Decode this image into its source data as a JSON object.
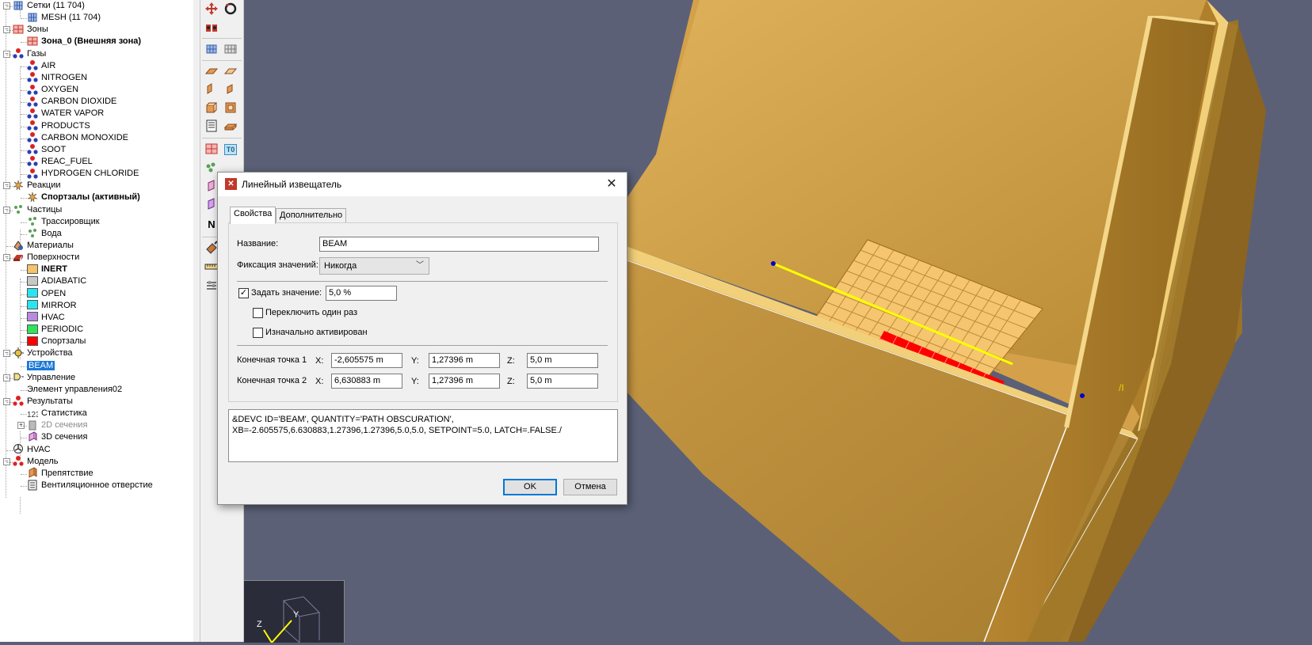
{
  "tree": {
    "items": [
      {
        "label": "Сетки (11 704)",
        "icon": "mesh-icon"
      },
      {
        "label": "MESH (11 704)",
        "icon": "mesh-icon"
      },
      {
        "label": "Зоны",
        "icon": "zone-icon"
      },
      {
        "label": "Зона_0 (Внешняя зона)",
        "icon": "zone-icon"
      },
      {
        "label": "Газы",
        "icon": "molecule-icon"
      },
      {
        "label": "AIR",
        "icon": "molecule-icon"
      },
      {
        "label": "NITROGEN",
        "icon": "molecule-icon"
      },
      {
        "label": "OXYGEN",
        "icon": "molecule-icon"
      },
      {
        "label": "CARBON DIOXIDE",
        "icon": "molecule-icon"
      },
      {
        "label": "WATER VAPOR",
        "icon": "molecule-icon"
      },
      {
        "label": "PRODUCTS",
        "icon": "molecule-icon"
      },
      {
        "label": "CARBON MONOXIDE",
        "icon": "molecule-icon"
      },
      {
        "label": "SOOT",
        "icon": "molecule-icon"
      },
      {
        "label": "REAC_FUEL",
        "icon": "molecule-icon"
      },
      {
        "label": "HYDROGEN CHLORIDE",
        "icon": "molecule-icon"
      },
      {
        "label": "Реакции",
        "icon": "reaction-icon"
      },
      {
        "label": "Спортзалы (активный)",
        "icon": "reaction-icon"
      },
      {
        "label": "Частицы",
        "icon": "particles-icon"
      },
      {
        "label": "Трассировщик",
        "icon": "particles-icon"
      },
      {
        "label": "Вода",
        "icon": "particles-icon"
      },
      {
        "label": "Материалы",
        "icon": "materials-icon"
      },
      {
        "label": "Поверхности",
        "icon": "surface-icon"
      },
      {
        "label": "INERT",
        "color": "#f5c36a"
      },
      {
        "label": "ADIABATIC",
        "color": "#c8c8c8"
      },
      {
        "label": "OPEN",
        "color": "#27e6f0"
      },
      {
        "label": "MIRROR",
        "color": "#27e6f0"
      },
      {
        "label": "HVAC",
        "color": "#b68be0"
      },
      {
        "label": "PERIODIC",
        "color": "#2fe35b"
      },
      {
        "label": "Спортзалы",
        "color": "#ff0000"
      },
      {
        "label": "Устройства",
        "icon": "devices-icon"
      },
      {
        "label": "BEAM",
        "icon": ""
      },
      {
        "label": "Управление",
        "icon": "control-icon"
      },
      {
        "label": "Элемент управления02",
        "icon": ""
      },
      {
        "label": "Результаты",
        "icon": "results-icon"
      },
      {
        "label": "Статистика",
        "icon": "statistics-icon"
      },
      {
        "label": "2D сечения",
        "icon": "slice2d-icon"
      },
      {
        "label": "3D сечения",
        "icon": "slice3d-icon"
      },
      {
        "label": "HVAC",
        "icon": "hvac-icon"
      },
      {
        "label": "Модель",
        "icon": "model-icon"
      },
      {
        "label": "Препятствие",
        "icon": "obstruction-icon"
      },
      {
        "label": "Вентиляционное отверстие",
        "icon": "vent-icon"
      }
    ]
  },
  "toolbar": {
    "to_label": "T0",
    "n_label": "N"
  },
  "viewport": {
    "axis_labels": {
      "z": "Z",
      "y": "Y"
    },
    "colors": {
      "background": "#5b6076",
      "wall": "#d9a94e",
      "wall_dark": "#a67b26",
      "floor_grid": "#f6c56f",
      "red_zone": "#ff0000",
      "beam": "#ffff00",
      "point": "#0000cc"
    }
  },
  "dialog": {
    "title": "Линейный извещатель",
    "tabs": [
      "Свойства",
      "Дополнительно"
    ],
    "name_label": "Название:",
    "name_value": "BEAM",
    "latch_label": "Фиксация значений:",
    "latch_value": "Никогда",
    "setpoint_label": "Задать значение:",
    "setpoint_checked": true,
    "setpoint_value": "5,0 %",
    "toggle_once_label": "Переключить один раз",
    "toggle_once_checked": false,
    "initially_active_label": "Изначально активирован",
    "initially_active_checked": false,
    "endpoint1_label": "Конечная точка 1",
    "endpoint2_label": "Конечная точка 2",
    "x_label": "X:",
    "y_label": "Y:",
    "z_label": "Z:",
    "p1": {
      "x": "-2,605575 m",
      "y": "1,27396 m",
      "z": "5,0 m"
    },
    "p2": {
      "x": "6,630883 m",
      "y": "1,27396 m",
      "z": "5,0 m"
    },
    "code": "&DEVC ID='BEAM', QUANTITY='PATH OBSCURATION',\nXB=-2.605575,6.630883,1.27396,1.27396,5.0,5.0, SETPOINT=5.0, LATCH=.FALSE./",
    "ok_label": "OK",
    "cancel_label": "Отмена"
  }
}
